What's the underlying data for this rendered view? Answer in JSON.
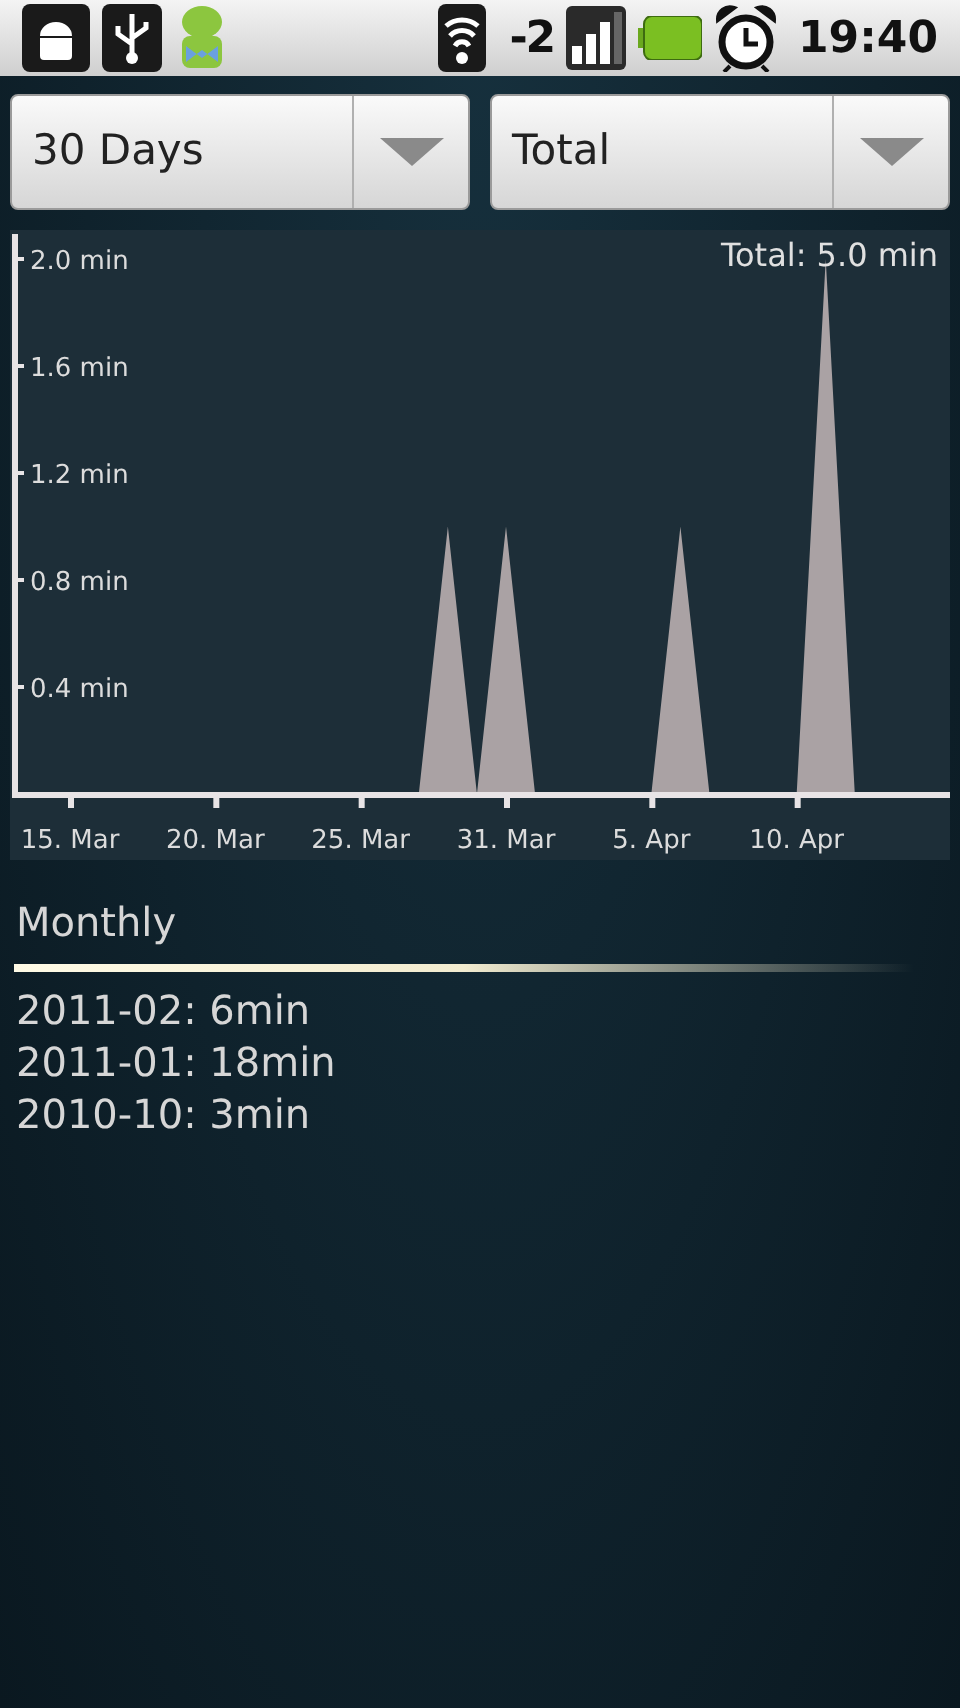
{
  "status_bar": {
    "signal_text": "-2",
    "time": "19:40"
  },
  "spinners": [
    {
      "value": "30 Days"
    },
    {
      "value": "Total"
    }
  ],
  "chart": {
    "total": "Total: 5.0 min",
    "chart_data": {
      "type": "area",
      "categories": [
        "15. Mar",
        null,
        null,
        null,
        null,
        "20. Mar",
        null,
        null,
        null,
        null,
        "25. Mar",
        null,
        null,
        null,
        null,
        "31. Mar",
        null,
        null,
        null,
        null,
        "5. Apr",
        null,
        null,
        null,
        null,
        "10. Apr",
        null,
        null,
        null,
        null,
        null
      ],
      "series": [
        {
          "color": "#aaa2a4",
          "values": [
            0,
            0,
            0,
            0,
            0,
            0,
            0,
            0,
            0,
            0,
            0,
            0,
            0,
            1.0,
            0,
            1.0,
            0,
            0,
            0,
            0,
            0,
            1.0,
            0,
            0,
            0,
            0,
            2.0,
            0,
            0,
            0,
            0
          ]
        }
      ],
      "ylim": [
        0,
        2.0
      ],
      "yticks": [
        {
          "value": 0.4,
          "label": "0.4 min"
        },
        {
          "value": 0.8,
          "label": "0.8 min"
        },
        {
          "value": 1.2,
          "label": "1.2 min"
        },
        {
          "value": 1.6,
          "label": "1.6 min"
        },
        {
          "value": 2.0,
          "label": "2.0 min"
        }
      ]
    }
  },
  "monthly": {
    "title": "Monthly",
    "items": [
      "2011-02: 6min",
      "2011-01: 18min",
      "2010-10: 3min"
    ]
  }
}
